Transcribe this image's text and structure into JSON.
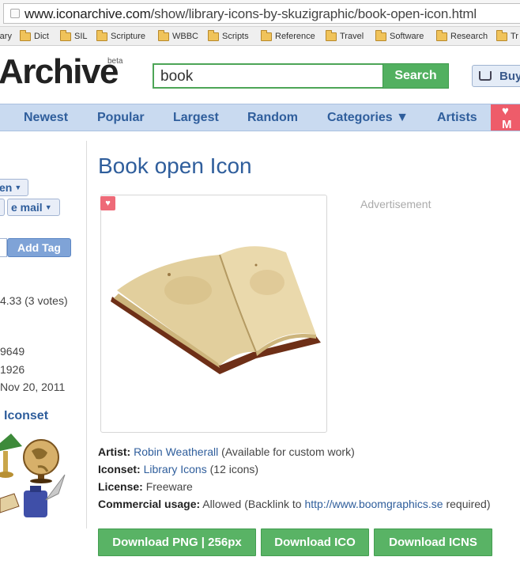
{
  "browser": {
    "url_domain": "www.iconarchive.com",
    "url_path": "/show/library-icons-by-skuzigraphic/book-open-icon.html",
    "bookmarks": [
      "rary",
      "Dict",
      "SIL",
      "Scripture",
      "WBBC",
      "Scripts",
      "Reference",
      "Travel",
      "Software",
      "Research",
      "Tr"
    ]
  },
  "header": {
    "logo_text": "Archive",
    "beta_label": "beta",
    "search_value": "book",
    "search_button": "Search",
    "buy_button": "Buy"
  },
  "nav": {
    "links": [
      "Newest",
      "Popular",
      "Largest",
      "Random",
      "Categories ▼",
      "Artists"
    ],
    "love_label": "♥ M"
  },
  "sidebar": {
    "pill_1": "en",
    "pill_2": "e mail",
    "add_tag_button": "Add Tag",
    "rating_text": "4.33 (3 votes)",
    "stat_1": "9649",
    "stat_2": "1926",
    "date_text": "Nov 20, 2011",
    "iconset_heading": "Iconset"
  },
  "main": {
    "title": "Book open Icon",
    "advertisement": "Advertisement",
    "artist_label": "Artist:",
    "artist_name": "Robin Weatherall",
    "artist_note": "(Available for custom work)",
    "iconset_label": "Iconset:",
    "iconset_name": "Library Icons",
    "iconset_count": "(12 icons)",
    "license_label": "License:",
    "license_value": "Freeware",
    "commercial_label": "Commercial usage:",
    "commercial_value": "Allowed (Backlink to",
    "commercial_link": "http://www.boomgraphics.se",
    "commercial_suffix": "required)"
  },
  "downloads": {
    "png": "Download PNG | 256px",
    "ico": "Download ICO",
    "icns": "Download ICNS"
  }
}
